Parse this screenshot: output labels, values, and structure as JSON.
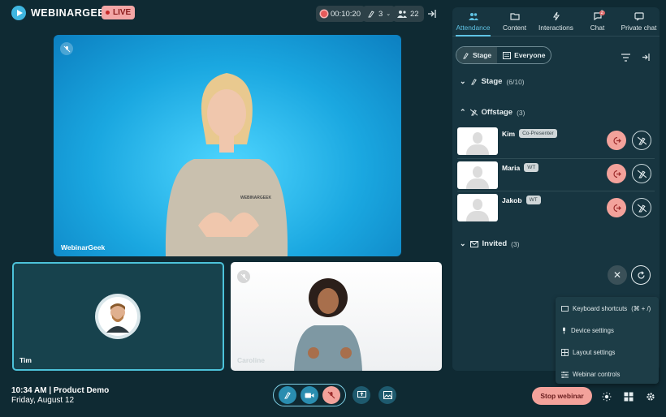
{
  "header": {
    "brand": "WEBINARGEEK",
    "live_label": "LIVE",
    "timer": "00:10:20",
    "raise_hand_count": "3",
    "attendee_count": "22"
  },
  "videos": {
    "main_label": "WebinarGeek",
    "tile1_label": "Tim",
    "tile2_label": "Caroline",
    "shirt_text": "WEBINARGEEK"
  },
  "panel": {
    "tabs": [
      {
        "label": "Attendance",
        "icon": "users-icon"
      },
      {
        "label": "Content",
        "icon": "folder-icon"
      },
      {
        "label": "Interactions",
        "icon": "lightning-icon"
      },
      {
        "label": "Chat",
        "icon": "chat-icon",
        "badge": "2"
      },
      {
        "label": "Private chat",
        "icon": "private-chat-icon"
      }
    ],
    "filter": {
      "stage": "Stage",
      "everyone": "Everyone"
    },
    "stage_section": {
      "title": "Stage",
      "count": "(6/10)"
    },
    "offstage_section": {
      "title": "Offstage",
      "count": "(3)"
    },
    "invited_section": {
      "title": "Invited",
      "count": "(3)"
    },
    "offstage_people": [
      {
        "name": "Kim",
        "role": "Co-Presenter"
      },
      {
        "name": "Maria",
        "role": "WT"
      },
      {
        "name": "Jakob",
        "role": "WT"
      }
    ]
  },
  "menu": {
    "items": [
      "Keyboard shortcuts",
      "Device settings",
      "Layout settings",
      "Webinar controls"
    ],
    "shortcut_hint": "(⌘ + /)"
  },
  "footer": {
    "time_title": "10:34 AM | Product Demo",
    "date": "Friday, August 12",
    "stop_label": "Stop webinar"
  },
  "colors": {
    "accent": "#5fc3e4",
    "danger": "#f3a29b",
    "background": "#0f2a33"
  }
}
